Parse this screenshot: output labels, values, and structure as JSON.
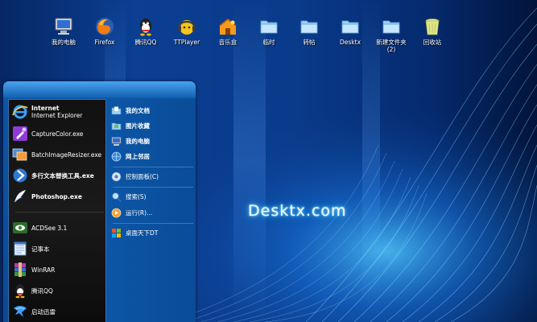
{
  "desktop": {
    "icons": [
      {
        "label": "我的电脑",
        "icon": "computer-icon"
      },
      {
        "label": "Firefox",
        "icon": "firefox-icon"
      },
      {
        "label": "腾讯QQ",
        "icon": "qq-icon"
      },
      {
        "label": "TTPlayer",
        "icon": "ttplayer-icon"
      },
      {
        "label": "音乐盒",
        "icon": "music-box-icon"
      },
      {
        "label": "临时",
        "icon": "folder-icon"
      },
      {
        "label": "转帖",
        "icon": "folder-icon"
      },
      {
        "label": "Desktx",
        "icon": "folder-icon"
      },
      {
        "label": "新建文件夹\n(2)",
        "icon": "folder-icon"
      },
      {
        "label": "回收站",
        "icon": "recycle-bin-icon"
      }
    ],
    "watermark": "Desktx.com"
  },
  "start_menu": {
    "pinned": {
      "ie_title": "Internet",
      "ie_subtitle": "Internet Explorer",
      "capturecolor": "CaptureColor.exe",
      "batch": "BatchImageResizer.exe",
      "multitext": "多行文本替换工具.exe",
      "photoshop": "Photoshop.exe"
    },
    "recent": {
      "acdsee": "ACDSee 3.1",
      "notepad": "记事本",
      "winrar": "WinRAR",
      "qq": "腾讯QQ",
      "thunder": "启动迅雷"
    },
    "right": {
      "my_documents": "我的文档",
      "my_pictures": "图片收藏",
      "my_computer": "我的电脑",
      "network": "网上邻居",
      "control_panel": "控制面板(C)",
      "search": "搜索(S)",
      "run": "运行(R)...",
      "desktop_download": "桌面天下DT"
    }
  },
  "colors": {
    "wallpaper_dark": "#021233",
    "wallpaper_mid": "#0a3c8f",
    "wallpaper_light": "#1d7fe0",
    "menu_blue": "#0a4c98",
    "menu_black": "#111111"
  }
}
